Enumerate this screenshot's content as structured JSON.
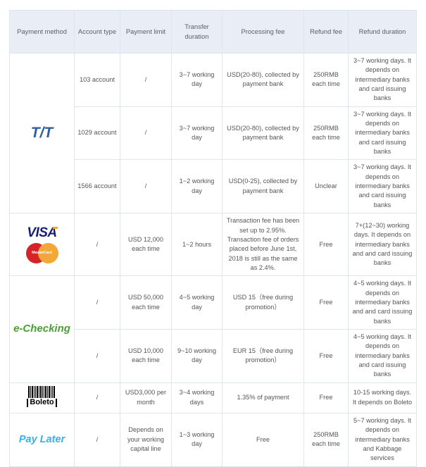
{
  "table": {
    "columns": [
      "Payment method",
      "Account type",
      "Payment limit",
      "Transfer duration",
      "Processing fee",
      "Refund fee",
      "Refund duration"
    ],
    "methods": [
      {
        "logo": "tt-logo",
        "label": "T/T",
        "rows": [
          {
            "account_type": "103 account",
            "payment_limit": "/",
            "transfer_duration": "3~7 working day",
            "processing_fee": "USD(20-80), collected by payment bank",
            "refund_fee": "250RMB each time",
            "refund_duration": "3~7 working days. It depends on intermediary banks and card issuing banks"
          },
          {
            "account_type": "1029 account",
            "payment_limit": "/",
            "transfer_duration": "3~7 working day",
            "processing_fee": "USD(20-80), collected by payment bank",
            "refund_fee": "250RMB each time",
            "refund_duration": "3~7 working days. It depends on intermediary banks and card issuing banks"
          },
          {
            "account_type": "1566 account",
            "payment_limit": "/",
            "transfer_duration": "1~2 working day",
            "processing_fee": "USD(0-25), collected by payment bank",
            "refund_fee": "Unclear",
            "refund_duration": "3~7 working days. It depends on intermediary banks and card issuing banks"
          }
        ]
      },
      {
        "logo": "visa-mastercard-logo",
        "label": "VISA MasterCard",
        "rows": [
          {
            "account_type": "/",
            "payment_limit": "USD 12,000 each time",
            "transfer_duration": "1~2 hours",
            "processing_fee": "Transaction fee has been set up to 2.95%. Transaction fee of orders placed before June 1st, 2018 is still as the same as 2.4%.",
            "refund_fee": "Free",
            "refund_duration": "7+(12~30) working days. It depends on intermediary banks and and card issuing banks"
          }
        ]
      },
      {
        "logo": "echecking-logo",
        "label": "e-Checking",
        "rows": [
          {
            "account_type": "/",
            "payment_limit": "USD 50,000 each time",
            "transfer_duration": "4~5 working day",
            "processing_fee": "USD 15（free during promotion）",
            "refund_fee": "Free",
            "refund_duration": "4~5 working days. It depends on intermediary banks and and card issuing banks"
          },
          {
            "account_type": "/",
            "payment_limit": "USD 10,000 each time",
            "transfer_duration": "9~10 working day",
            "processing_fee": "EUR 15（free during promotion）",
            "refund_fee": "Free",
            "refund_duration": "4~5 working days. It depends on intermediary banks and card issuing banks"
          }
        ]
      },
      {
        "logo": "boleto-logo",
        "label": "Boleto",
        "rows": [
          {
            "account_type": "/",
            "payment_limit": "USD3,000 per month",
            "transfer_duration": "3~4 working days",
            "processing_fee": "1.35% of payment",
            "refund_fee": "Free",
            "refund_duration": "10-15 working days. It depends on Boleto"
          }
        ]
      },
      {
        "logo": "paylater-logo",
        "label": "Pay Later",
        "rows": [
          {
            "account_type": "/",
            "payment_limit": "Depends on your working capital line",
            "transfer_duration": "1~3 working day",
            "processing_fee": "Free",
            "refund_fee": "250RMB each time",
            "refund_duration": "5~7 working days. It depends on intermediary banks and Kabbage services"
          }
        ]
      }
    ]
  },
  "logos": {
    "tt_text": "T/T",
    "visa_text": "VISA",
    "mastercard_text": "MasterCard",
    "echecking_text": "e-Checking",
    "boleto_text": "Boleto",
    "paylater_text": "Pay Later"
  },
  "colors": {
    "header_bg": "#e9eef6",
    "border": "#dfe5ef",
    "tt_blue": "#2f5f9e",
    "visa_blue": "#1a1f71",
    "visa_gold": "#f7a823",
    "mastercard_red": "#d6232a",
    "mastercard_yellow": "#f2a73b",
    "echecking_green": "#4a9e35",
    "paylater_blue": "#35b0f0",
    "text": "#555555"
  }
}
